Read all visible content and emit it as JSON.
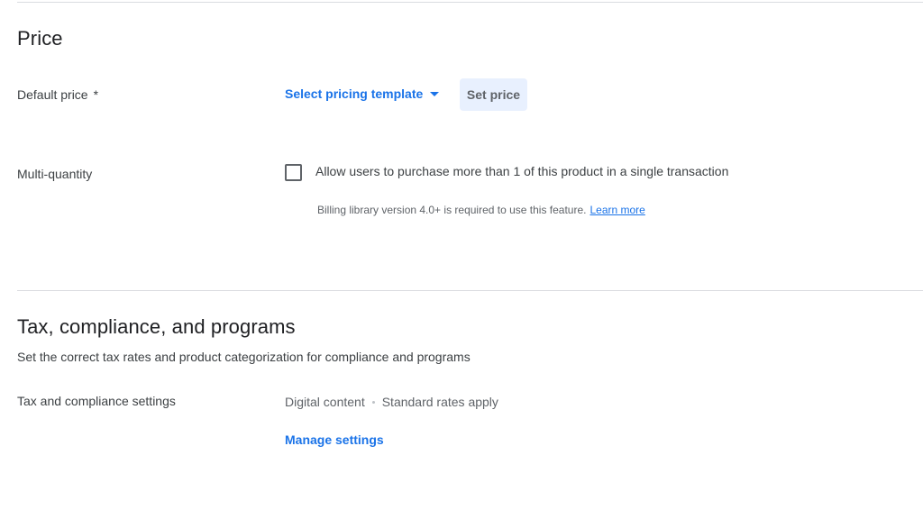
{
  "price_section": {
    "title": "Price",
    "default_price": {
      "label": "Default price",
      "required_marker": "*",
      "template_select_label": "Select pricing template",
      "set_price_label": "Set price"
    },
    "multi_quantity": {
      "label": "Multi-quantity",
      "checkbox_label": "Allow users to purchase more than 1 of this product in a single transaction",
      "checked": false,
      "hint_text": "Billing library version 4.0+ is required to use this feature.",
      "learn_more_label": "Learn more"
    }
  },
  "tax_section": {
    "title": "Tax, compliance, and programs",
    "subtitle": "Set the correct tax rates and product categorization for compliance and programs",
    "settings": {
      "label": "Tax and compliance settings",
      "value_primary": "Digital content",
      "value_secondary": "Standard rates apply",
      "manage_label": "Manage settings"
    }
  },
  "icons": {
    "dropdown": "caret-down-icon",
    "checkbox": "checkbox-unchecked-icon",
    "separator": "dot-separator-icon"
  },
  "colors": {
    "accent": "#1a73e8",
    "button_bg": "#e8f0fe",
    "divider": "#dadce0"
  }
}
